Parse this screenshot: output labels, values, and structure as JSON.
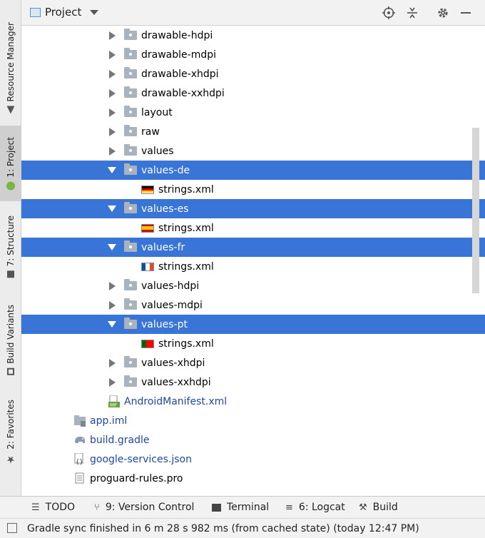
{
  "sidebar": {
    "resource_manager": "Resource Manager",
    "project": "1: Project",
    "structure": "7: Structure",
    "build_variants": "Build Variants",
    "favorites": "2: Favorites"
  },
  "header": {
    "view_selector": "Project",
    "icons": [
      "locate-icon",
      "collapse-all-icon",
      "gear-icon",
      "minimize-icon"
    ]
  },
  "tree": [
    {
      "label": "drawable-hdpi",
      "type": "folder",
      "selected": false
    },
    {
      "label": "drawable-mdpi",
      "type": "folder",
      "selected": false
    },
    {
      "label": "drawable-xhdpi",
      "type": "folder",
      "selected": false
    },
    {
      "label": "drawable-xxhdpi",
      "type": "folder",
      "selected": false
    },
    {
      "label": "layout",
      "type": "folder",
      "selected": false
    },
    {
      "label": "raw",
      "type": "folder",
      "selected": false
    },
    {
      "label": "values",
      "type": "folder",
      "selected": false
    },
    {
      "label": "values-de",
      "type": "folder",
      "selected": true,
      "expanded": true
    },
    {
      "label": "strings.xml",
      "type": "file",
      "flag": "de"
    },
    {
      "label": "values-es",
      "type": "folder",
      "selected": true,
      "expanded": true
    },
    {
      "label": "strings.xml",
      "type": "file",
      "flag": "es"
    },
    {
      "label": "values-fr",
      "type": "folder",
      "selected": true,
      "expanded": true
    },
    {
      "label": "strings.xml",
      "type": "file",
      "flag": "fr"
    },
    {
      "label": "values-hdpi",
      "type": "folder",
      "selected": false
    },
    {
      "label": "values-mdpi",
      "type": "folder",
      "selected": false
    },
    {
      "label": "values-pt",
      "type": "folder",
      "selected": true,
      "expanded": true
    },
    {
      "label": "strings.xml",
      "type": "file",
      "flag": "pt"
    },
    {
      "label": "values-xhdpi",
      "type": "folder",
      "selected": false
    },
    {
      "label": "values-xxhdpi",
      "type": "folder",
      "selected": false
    },
    {
      "label": "AndroidManifest.xml",
      "type": "manifest"
    },
    {
      "label": "app.iml",
      "type": "iml"
    },
    {
      "label": "build.gradle",
      "type": "gradle"
    },
    {
      "label": "google-services.json",
      "type": "json"
    },
    {
      "label": "proguard-rules.pro",
      "type": "pro"
    }
  ],
  "toolbar": {
    "todo": "TODO",
    "version_control": "9: Version Control",
    "terminal": "Terminal",
    "logcat": "6: Logcat",
    "build": "Build"
  },
  "status": {
    "message": "Gradle sync finished in 6 m 28 s 982 ms (from cached state) (today 12:47 PM)"
  },
  "colors": {
    "selection": "#3875d7",
    "link_text": "#1f47a8"
  }
}
